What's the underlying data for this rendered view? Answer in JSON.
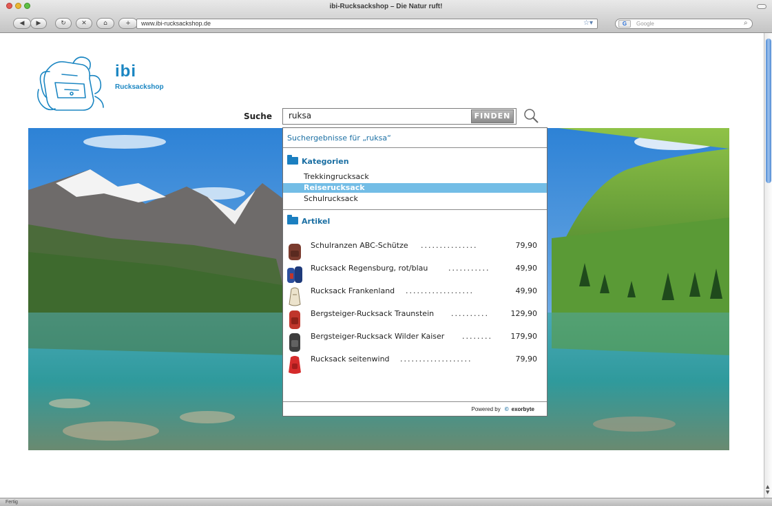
{
  "browser": {
    "window_title": "ibi-Rucksackshop – Die Natur ruft!",
    "url": "www.ibi-rucksackshop.de",
    "search_placeholder": "Google",
    "status_text": "Fertig",
    "nav": {
      "back": "◀",
      "forward": "▶",
      "reload": "↻",
      "stop": "✕",
      "home": "⌂",
      "add": "+"
    }
  },
  "brand": {
    "mark": "ibi",
    "name": "Rucksackshop"
  },
  "search": {
    "label": "Suche",
    "query": "ruksa",
    "button": "FINDEN"
  },
  "suggest": {
    "heading": "Suchergebnisse für „ruksa“",
    "categories_title": "Kategorien",
    "categories": [
      {
        "label": "Trekkingrucksack",
        "selected": false
      },
      {
        "label": "Reiserucksack",
        "selected": true
      },
      {
        "label": "Schulrucksack",
        "selected": false
      }
    ],
    "articles_title": "Artikel",
    "articles": [
      {
        "name": "Schulranzen ABC-Schütze",
        "leader": "...............",
        "price": "79,90",
        "color": "#7a3b2e"
      },
      {
        "name": "Rucksack Regensburg, rot/blau",
        "leader": "...........",
        "price": "49,90",
        "color": "#2d4f9e"
      },
      {
        "name": "Rucksack Frankenland",
        "leader": "..................",
        "price": "49,90",
        "color": "#d8c9a6"
      },
      {
        "name": "Bergsteiger-Rucksack Traunstein",
        "leader": "..........",
        "price": "129,90",
        "color": "#c0362c"
      },
      {
        "name": "Bergsteiger-Rucksack Wilder Kaiser",
        "leader": "........",
        "price": "179,90",
        "color": "#3e3e3e"
      },
      {
        "name": "Rucksack seitenwind",
        "leader": "...................",
        "price": "79,90",
        "color": "#d52b2b"
      }
    ],
    "powered_by": "Powered by",
    "powered_brand": "exorbyte"
  },
  "colors": {
    "accent": "#1b86c2",
    "selection": "#73bde6",
    "link": "#1b6fa3"
  }
}
